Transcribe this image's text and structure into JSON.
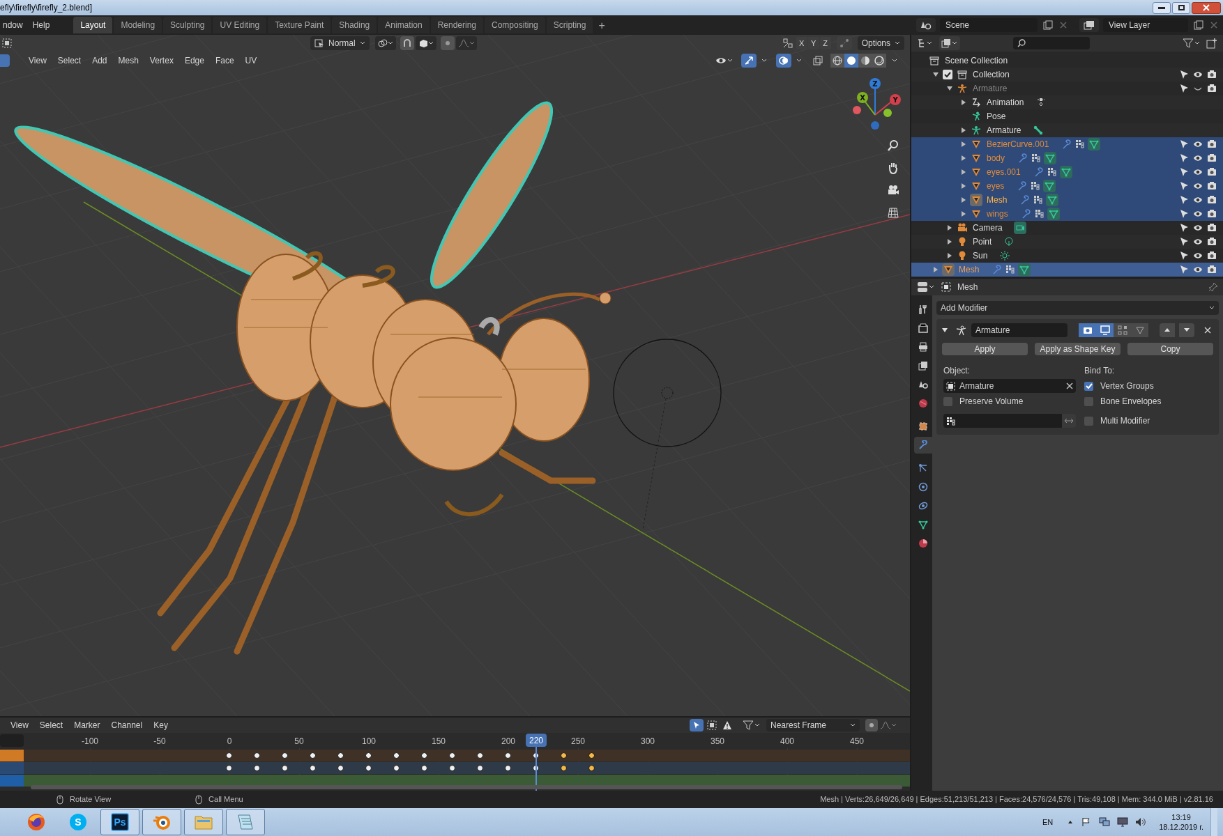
{
  "window": {
    "title": "efly\\firefly\\firefly_2.blend]"
  },
  "menu": [
    "ndow",
    "Help"
  ],
  "workspaces": [
    {
      "label": "Layout",
      "selected": true
    },
    {
      "label": "Modeling",
      "selected": false
    },
    {
      "label": "Sculpting",
      "selected": false
    },
    {
      "label": "UV Editing",
      "selected": false
    },
    {
      "label": "Texture Paint",
      "selected": false
    },
    {
      "label": "Shading",
      "selected": false
    },
    {
      "label": "Animation",
      "selected": false
    },
    {
      "label": "Rendering",
      "selected": false
    },
    {
      "label": "Compositing",
      "selected": false
    },
    {
      "label": "Scripting",
      "selected": false
    }
  ],
  "add_workspace": "+",
  "scene": "Scene",
  "view_layer": "View Layer",
  "viewport": {
    "mode": "Normal",
    "axes": [
      "X",
      "Y",
      "Z"
    ],
    "options": "Options",
    "menu": [
      "View",
      "Select",
      "Add",
      "Mesh",
      "Vertex",
      "Edge",
      "Face",
      "UV"
    ],
    "shading": [
      {
        "kind": "wireframe",
        "selected": false
      },
      {
        "kind": "solid",
        "selected": true
      },
      {
        "kind": "material",
        "selected": false
      },
      {
        "kind": "rendered",
        "selected": false
      }
    ],
    "gizmo": [
      "X",
      "Y",
      "Z"
    ]
  },
  "outliner": {
    "items": [
      {
        "name": "Scene Collection",
        "kind": "scene-collection",
        "selected": false,
        "children": [
          {
            "name": "Collection",
            "kind": "collection",
            "selected": false,
            "expanded": true,
            "checked": true,
            "restrict": {
              "visible": true
            },
            "children": [
              {
                "name": "Armature",
                "kind": "armature",
                "selected": false,
                "expanded": true,
                "restrict": {
                  "visible": false
                },
                "children": [
                  {
                    "name": "Animation",
                    "kind": "action",
                    "selected": false,
                    "expanded": false
                  },
                  {
                    "name": "Pose",
                    "kind": "pose",
                    "selected": false
                  },
                  {
                    "name": "Armature",
                    "kind": "armature-data",
                    "selected": false,
                    "expanded": false
                  },
                  {
                    "name": "BezierCurve.001",
                    "kind": "mesh",
                    "selected": true,
                    "expanded": false,
                    "restrict": {
                      "visible": true
                    }
                  },
                  {
                    "name": "body",
                    "kind": "mesh",
                    "selected": true,
                    "expanded": false,
                    "restrict": {
                      "visible": true
                    }
                  },
                  {
                    "name": "eyes.001",
                    "kind": "mesh",
                    "selected": true,
                    "expanded": false,
                    "restrict": {
                      "visible": true
                    }
                  },
                  {
                    "name": "eyes",
                    "kind": "mesh",
                    "selected": true,
                    "expanded": false,
                    "restrict": {
                      "visible": true
                    }
                  },
                  {
                    "name": "Mesh",
                    "kind": "mesh",
                    "selected": true,
                    "active": true,
                    "expanded": false,
                    "restrict": {
                      "visible": true
                    }
                  },
                  {
                    "name": "wings",
                    "kind": "mesh",
                    "selected": true,
                    "expanded": false,
                    "restrict": {
                      "visible": true
                    }
                  }
                ]
              },
              {
                "name": "Camera",
                "kind": "camera",
                "selected": false,
                "expanded": false,
                "restrict": {
                  "visible": true
                }
              },
              {
                "name": "Point",
                "kind": "point-light",
                "selected": false,
                "expanded": false,
                "restrict": {
                  "visible": true
                }
              },
              {
                "name": "Sun",
                "kind": "sun-light",
                "selected": false,
                "expanded": false,
                "restrict": {
                  "visible": true
                }
              }
            ]
          },
          {
            "name": "Mesh",
            "kind": "mesh",
            "selected": true,
            "active": true,
            "highlight": true,
            "expanded": false,
            "restrict": {
              "visible": true
            }
          }
        ]
      }
    ]
  },
  "properties": {
    "context": "Mesh",
    "tabs": [
      {
        "kind": "tool",
        "selected": false
      },
      {
        "kind": "render",
        "selected": false
      },
      {
        "kind": "output",
        "selected": false
      },
      {
        "kind": "view-layer",
        "selected": false
      },
      {
        "kind": "scene",
        "selected": false
      },
      {
        "kind": "world",
        "selected": false
      },
      {
        "kind": "object",
        "selected": false
      },
      {
        "kind": "modifiers",
        "selected": true
      },
      {
        "kind": "particles",
        "selected": false
      },
      {
        "kind": "physics",
        "selected": false
      },
      {
        "kind": "constraints",
        "selected": false
      },
      {
        "kind": "data",
        "selected": false
      },
      {
        "kind": "material",
        "selected": false
      }
    ],
    "add_modifier": "Add Modifier",
    "modifier": {
      "name": "Armature",
      "expanded": true,
      "toggles": [
        {
          "kind": "render",
          "on": true
        },
        {
          "kind": "viewport",
          "on": true
        },
        {
          "kind": "editmode",
          "on": false
        },
        {
          "kind": "cage",
          "on": false
        }
      ],
      "buttons": [
        "Apply",
        "Apply as Shape Key",
        "Copy"
      ],
      "object_label": "Object:",
      "object": "Armature",
      "bind_label": "Bind To:",
      "options": [
        {
          "label": "Preserve Volume",
          "checked": false
        },
        {
          "label": "Vertex Groups",
          "checked": true
        },
        {
          "label": "Bone Envelopes",
          "checked": false
        },
        {
          "label": "Multi Modifier",
          "checked": false
        }
      ]
    }
  },
  "timeline": {
    "menu": [
      "View",
      "Select",
      "Marker",
      "Channel",
      "Key"
    ],
    "snap": "Nearest Frame",
    "ruler": [
      "-100",
      "-50",
      "0",
      "50",
      "100",
      "150",
      "200",
      "250",
      "300",
      "350",
      "400",
      "450"
    ],
    "current_frame": "220",
    "channels": [
      {
        "color": "#d17a26",
        "keys": [
          {
            "selected": false
          },
          {
            "selected": false
          },
          {
            "selected": false
          },
          {
            "selected": false
          },
          {
            "selected": false
          },
          {
            "selected": false
          },
          {
            "selected": false
          },
          {
            "selected": false
          },
          {
            "selected": false
          },
          {
            "selected": false
          },
          {
            "selected": false
          },
          {
            "selected": false
          },
          {
            "selected": true
          },
          {
            "selected": true
          }
        ]
      },
      {
        "color": "#2a4a73",
        "keys": [
          {
            "selected": false
          },
          {
            "selected": false
          },
          {
            "selected": false
          },
          {
            "selected": false
          },
          {
            "selected": false
          },
          {
            "selected": false
          },
          {
            "selected": false
          },
          {
            "selected": false
          },
          {
            "selected": false
          },
          {
            "selected": false
          },
          {
            "selected": false
          },
          {
            "selected": false
          },
          {
            "selected": true
          },
          {
            "selected": true
          }
        ]
      },
      {
        "color": "#1e5fa8"
      }
    ]
  },
  "status_bar": {
    "hints": [
      "Rotate View",
      "Call Menu"
    ],
    "stats": "Mesh | Verts:26,649/26,649 | Edges:51,213/51,213 | Faces:24,576/24,576 | Tris:49,108 | Mem: 344.0 MiB | v2.81.16"
  },
  "taskbar": {
    "apps": [
      {
        "kind": "firefox",
        "running": false
      },
      {
        "kind": "skype",
        "label": "S",
        "running": false
      },
      {
        "kind": "photoshop",
        "label": "Ps",
        "running": true
      },
      {
        "kind": "blender",
        "running": true
      },
      {
        "kind": "explorer",
        "running": true
      },
      {
        "kind": "notepad",
        "running": true
      }
    ],
    "language": "EN",
    "time": "13:19",
    "date": "18.12.2019 г."
  }
}
